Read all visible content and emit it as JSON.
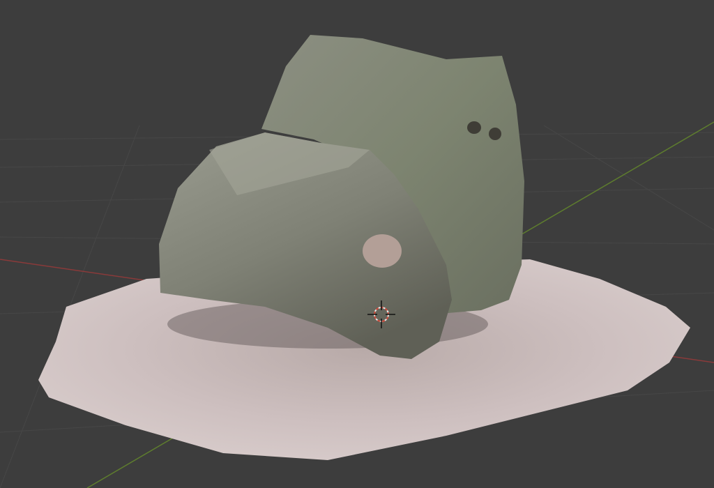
{
  "viewport": {
    "background_color": "#3d3d3d",
    "grid_color": "#474747",
    "x_axis_color": "#8a3a3a",
    "y_axis_color": "#5e7d2e",
    "icons": [
      "3d-cursor-icon"
    ]
  },
  "scene": {
    "ground_color": "#cdbfbf",
    "rock_color": "#858a7a"
  }
}
